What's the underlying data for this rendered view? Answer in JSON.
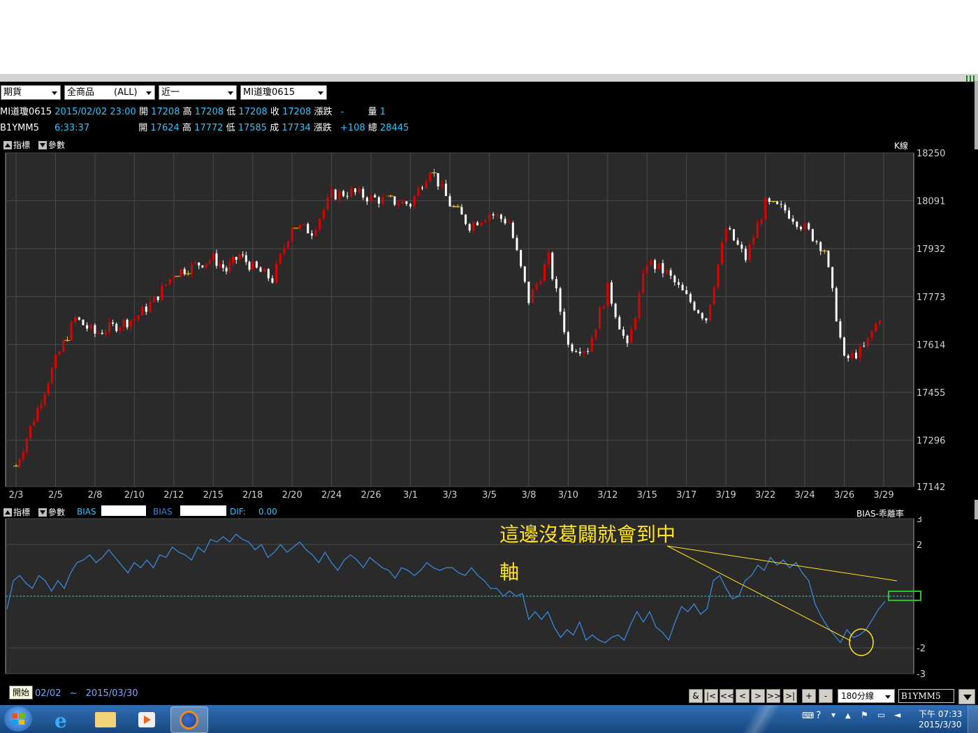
{
  "toolbar": {
    "market": "期貨",
    "category": "全商品",
    "category_filter": "(ALL)",
    "period": "近一",
    "symbol": "MI道瓊0615"
  },
  "quote1": {
    "symbol": "MI道瓊0615",
    "datetime": "2015/02/02 23:00",
    "open_label": "開",
    "open": "17208",
    "high_label": "高",
    "high": "17208",
    "low_label": "低",
    "low": "17208",
    "close_label": "收",
    "close": "17208",
    "change_label": "漲跌",
    "change": "-",
    "volume_label": "量",
    "volume": "1"
  },
  "quote2": {
    "symbol": "B1YMM5",
    "time": "6:33:37",
    "open_label": "開",
    "open": "17624",
    "high_label": "高",
    "high": "17772",
    "low_label": "低",
    "low": "17585",
    "last_label": "成",
    "last": "17734",
    "change_label": "漲跌",
    "change": "+108",
    "total_label": "總",
    "total": "28445"
  },
  "upper_panel": {
    "indicator_label": "指標",
    "param_label": "參數",
    "chart_name": "K線"
  },
  "lower_panel": {
    "indicator_label": "指標",
    "param_label": "參數",
    "bias1_label": "BIAS",
    "bias2_label": "BIAS",
    "dif_label": "DIF:",
    "dif_value": "0.00",
    "chart_name": "BIAS-乖離率"
  },
  "annotation": {
    "line1": "這邊沒葛闢就會到中",
    "line2": "軸"
  },
  "bottom": {
    "start_button": "開始",
    "date_from": "02/02",
    "tilde": "~",
    "date_to": "2015/03/30",
    "nav_buttons": [
      "&",
      "|<",
      "<<",
      "<",
      ">",
      ">>",
      ">|",
      "+",
      "-"
    ],
    "interval": "180分線",
    "symbol_input": "B1YMM5"
  },
  "taskbar": {
    "time": "下午 07:33",
    "date": "2015/3/30",
    "apps": [
      "windows-start-icon",
      "ie-icon",
      "explorer-icon",
      "media-player-icon",
      "firefox-icon"
    ]
  },
  "colors": {
    "up": "#e00000",
    "down": "#ffffff",
    "flat": "#ffd400",
    "bias_line": "#3a86d8",
    "zero_line": "#2ec4c4",
    "annotation": "#ffe51a"
  },
  "chart_data": [
    {
      "type": "candlestick",
      "title": "K線",
      "ylim": [
        17142,
        18250
      ],
      "y_ticks": [
        "18250",
        "18091",
        "17932",
        "17773",
        "17614",
        "17455",
        "17296",
        "17142"
      ],
      "x_ticks": [
        "2/3",
        "2/5",
        "2/8",
        "2/10",
        "2/12",
        "2/15",
        "2/18",
        "2/20",
        "2/24",
        "2/26",
        "3/1",
        "3/3",
        "3/5",
        "3/8",
        "3/10",
        "3/12",
        "3/15",
        "3/17",
        "3/19",
        "3/22",
        "3/24",
        "3/26",
        "3/29"
      ],
      "grid": true,
      "close_path": [
        {
          "x": "2/3",
          "close": 17210
        },
        {
          "x": "2/5",
          "close": 17560
        },
        {
          "x": "2/6",
          "close": 17700
        },
        {
          "x": "2/8",
          "close": 17650
        },
        {
          "x": "2/10",
          "close": 17700
        },
        {
          "x": "2/11",
          "close": 17760
        },
        {
          "x": "2/12",
          "close": 17850
        },
        {
          "x": "2/15",
          "close": 17900
        },
        {
          "x": "2/16",
          "close": 17860
        },
        {
          "x": "2/17",
          "close": 17910
        },
        {
          "x": "2/18",
          "close": 17870
        },
        {
          "x": "2/19",
          "close": 17830
        },
        {
          "x": "2/20",
          "close": 18010
        },
        {
          "x": "2/23",
          "close": 17990
        },
        {
          "x": "2/24",
          "close": 18110
        },
        {
          "x": "2/25",
          "close": 18120
        },
        {
          "x": "2/26",
          "close": 18100
        },
        {
          "x": "2/27",
          "close": 18090
        },
        {
          "x": "3/1",
          "close": 18080
        },
        {
          "x": "3/2",
          "close": 18200
        },
        {
          "x": "3/3",
          "close": 18080
        },
        {
          "x": "3/4",
          "close": 18010
        },
        {
          "x": "3/5",
          "close": 18050
        },
        {
          "x": "3/6",
          "close": 18020
        },
        {
          "x": "3/8",
          "close": 17760
        },
        {
          "x": "3/9",
          "close": 17900
        },
        {
          "x": "3/10",
          "close": 17610
        },
        {
          "x": "3/11",
          "close": 17600
        },
        {
          "x": "3/12",
          "close": 17800
        },
        {
          "x": "3/13",
          "close": 17600
        },
        {
          "x": "3/15",
          "close": 17890
        },
        {
          "x": "3/16",
          "close": 17850
        },
        {
          "x": "3/17",
          "close": 17770
        },
        {
          "x": "3/18",
          "close": 17700
        },
        {
          "x": "3/19",
          "close": 18000
        },
        {
          "x": "3/20",
          "close": 17900
        },
        {
          "x": "3/22",
          "close": 18080
        },
        {
          "x": "3/23",
          "close": 18060
        },
        {
          "x": "3/24",
          "close": 18000
        },
        {
          "x": "3/25",
          "close": 17930
        },
        {
          "x": "3/26",
          "close": 17560
        },
        {
          "x": "3/27",
          "close": 17600
        },
        {
          "x": "3/29",
          "close": 17734
        }
      ]
    },
    {
      "type": "line",
      "title": "BIAS-乖離率",
      "ylim": [
        -3,
        3
      ],
      "y_ticks": [
        "3",
        "2",
        "-2",
        "-3"
      ],
      "grid": true,
      "series": [
        {
          "values": [
            -0.5,
            0.6,
            0.8,
            0.5,
            0.3,
            0.8,
            0.6,
            0.2,
            0.6,
            0.3,
            0.9,
            1.3,
            1.4,
            1.6,
            1.3,
            1.5,
            1.8,
            1.5,
            1.2,
            0.9,
            1.3,
            1.1,
            1.4,
            1.1,
            1.6,
            1.5,
            1.9,
            1.7,
            1.6,
            1.4,
            1.9,
            1.7,
            2.2,
            2.1,
            2.3,
            2.1,
            2.4,
            2.2,
            2.1,
            1.8,
            2.0,
            1.5,
            1.7,
            2.0,
            1.7,
            1.9,
            2.1,
            1.8,
            1.6,
            1.3,
            1.7,
            1.3,
            1.0,
            1.4,
            1.6,
            1.4,
            1.1,
            1.5,
            1.3,
            1.1,
            1.0,
            0.7,
            1.1,
            1.0,
            0.8,
            1.0,
            1.3,
            1.1,
            1.0,
            1.1,
            1.1,
            0.9,
            0.8,
            1.1,
            0.8,
            0.6,
            0.3,
            0.3,
            0.0,
            0.2,
            0.0,
            0.1,
            -0.9,
            -0.6,
            -0.9,
            -0.6,
            -1.2,
            -1.6,
            -1.3,
            -1.5,
            -1.0,
            -1.7,
            -1.5,
            -1.7,
            -1.8,
            -1.6,
            -1.5,
            -1.7,
            -1.1,
            -0.6,
            -1.0,
            -0.6,
            -1.2,
            -1.4,
            -1.7,
            -1.0,
            -0.4,
            -0.6,
            -0.3,
            -0.7,
            -0.5,
            0.6,
            0.8,
            0.3,
            -0.1,
            0.0,
            0.6,
            0.8,
            1.2,
            1.0,
            1.5,
            1.2,
            1.4,
            1.1,
            1.3,
            0.9,
            0.6,
            -0.3,
            -0.8,
            -1.2,
            -1.5,
            -1.8,
            -1.3,
            -1.6,
            -1.5,
            -1.3,
            -0.9,
            -0.5,
            -0.2
          ]
        }
      ],
      "zero_line": 0
    }
  ]
}
